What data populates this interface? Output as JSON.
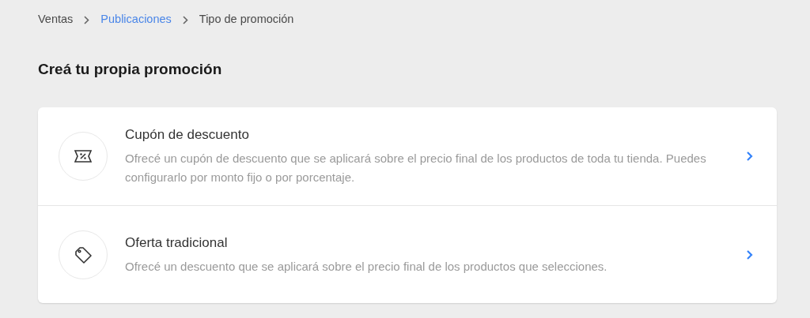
{
  "breadcrumb": [
    {
      "label": "Ventas",
      "kind": "plain"
    },
    {
      "label": "Publicaciones",
      "kind": "link"
    },
    {
      "label": "Tipo de promoción",
      "kind": "plain"
    }
  ],
  "title": "Creá tu propia promoción",
  "options": [
    {
      "kind": "coupon",
      "title": "Cupón de descuento",
      "description": "Ofrecé un cupón de descuento que se aplicará sobre el precio final de los productos de toda tu tienda. Puedes configurarlo por monto fijo o por porcentaje."
    },
    {
      "kind": "tag",
      "title": "Oferta tradicional",
      "description": "Ofrecé un descuento que se aplicará sobre el precio final de los productos que selecciones."
    }
  ]
}
